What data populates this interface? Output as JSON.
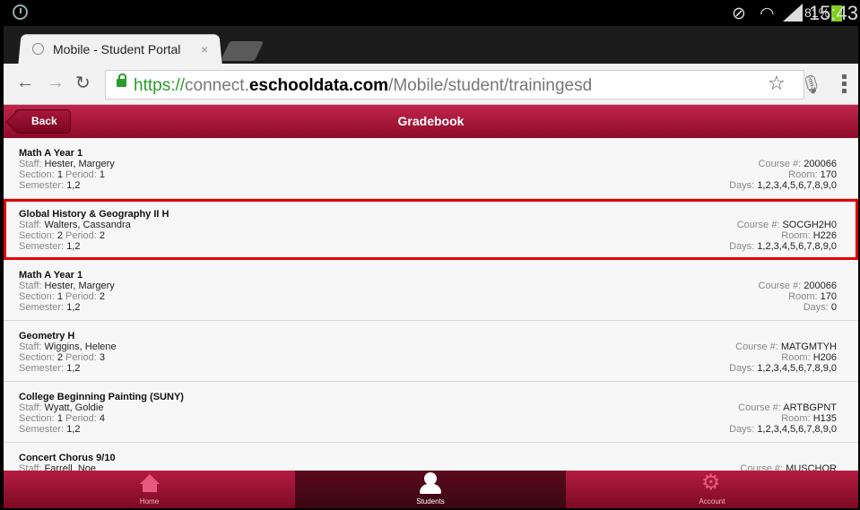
{
  "status_bar": {
    "battery_percent": "81%",
    "time": "15:43",
    "battery_color": "#7fce1d"
  },
  "browser": {
    "tab_title": "Mobile - Student Portal",
    "tab_close": "×",
    "url_scheme": "https://",
    "url_subdomain": "connect.",
    "url_host": "eschooldata.com",
    "url_path": "/Mobile/student/trainingesd"
  },
  "header": {
    "back_label": "Back",
    "title": "Gradebook",
    "color": "#a8163c"
  },
  "labels": {
    "staff": "Staff: ",
    "section": "Section: ",
    "period": "Period: ",
    "semester": "Semester: ",
    "course_no": "Course #: ",
    "room": "Room: ",
    "days": "Days: "
  },
  "courses": [
    {
      "name": "Math A Year 1",
      "staff": "Hester, Margery",
      "section": "1",
      "period": "1",
      "semester": "1,2",
      "course_no": "200066",
      "room": "170",
      "days": "1,2,3,4,5,6,7,8,9,0"
    },
    {
      "name": "Global History & Geography II H",
      "staff": "Walters, Cassandra",
      "section": "2",
      "period": "2",
      "semester": "1,2",
      "course_no": "SOCGH2H0",
      "room": "H226",
      "days": "1,2,3,4,5,6,7,8,9,0"
    },
    {
      "name": "Math A Year 1",
      "staff": "Hester, Margery",
      "section": "1",
      "period": "2",
      "semester": "1,2",
      "course_no": "200066",
      "room": "170",
      "days": "0"
    },
    {
      "name": "Geometry H",
      "staff": "Wiggins, Helene",
      "section": "2",
      "period": "3",
      "semester": "1,2",
      "course_no": "MATGMTYH",
      "room": "H206",
      "days": "1,2,3,4,5,6,7,8,9,0"
    },
    {
      "name": "College Beginning Painting (SUNY)",
      "staff": "Wyatt, Goldie",
      "section": "1",
      "period": "4",
      "semester": "1,2",
      "course_no": "ARTBGPNT",
      "room": "H135",
      "days": "1,2,3,4,5,6,7,8,9,0"
    },
    {
      "name": "Concert Chorus 9/10",
      "staff": "Farrell, Noe",
      "course_no": "MUSCHOR"
    }
  ],
  "highlighted_row": 1,
  "bottom_tabs": [
    {
      "label": "Home",
      "icon": "home-icon"
    },
    {
      "label": "Students",
      "icon": "user-icon",
      "active": true
    },
    {
      "label": "Account",
      "icon": "gear-icon"
    }
  ]
}
